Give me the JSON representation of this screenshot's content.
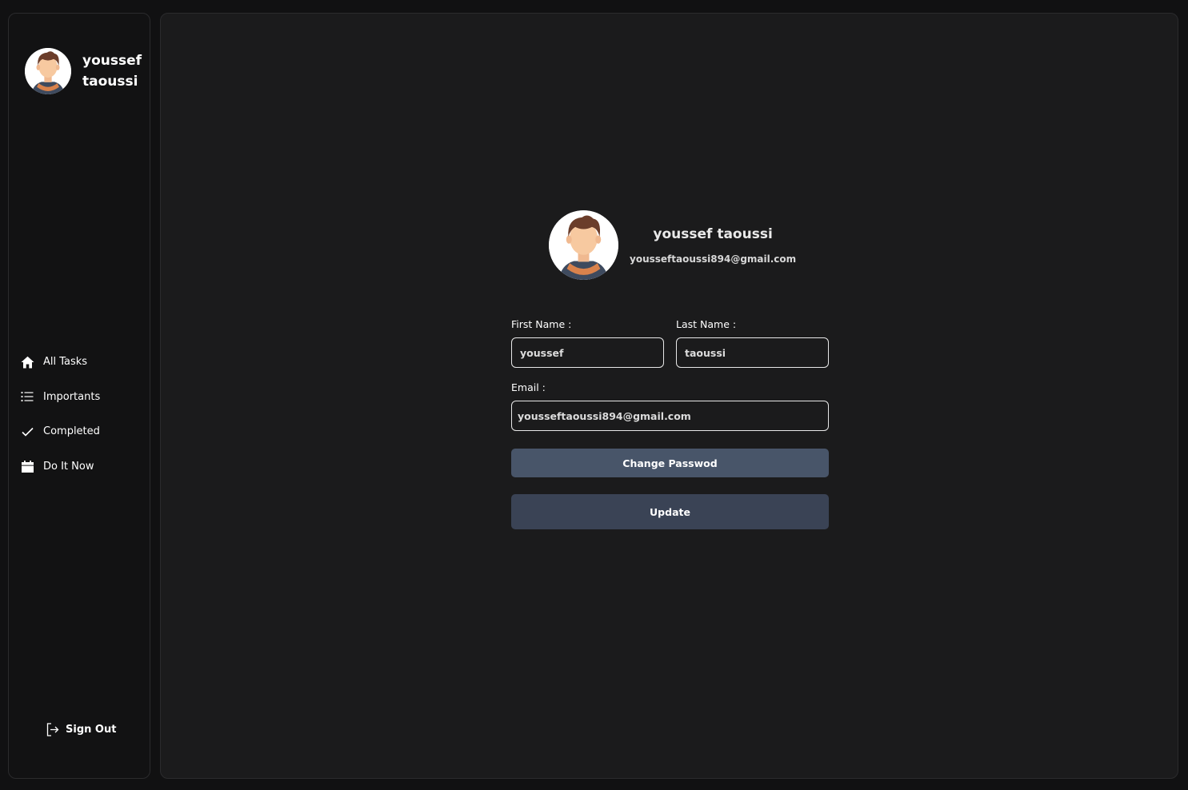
{
  "user": {
    "display_name_line1": "youssef",
    "display_name_line2": "taoussi",
    "full_name": "youssef taoussi",
    "email": "yousseftaoussi894@gmail.com"
  },
  "nav": {
    "items": [
      {
        "label": "All Tasks",
        "icon": "home-icon"
      },
      {
        "label": "Importants",
        "icon": "list-icon"
      },
      {
        "label": "Completed",
        "icon": "check-icon"
      },
      {
        "label": "Do It Now",
        "icon": "calendar-icon"
      }
    ],
    "sign_out": {
      "label": "Sign Out",
      "icon": "sign-out-icon"
    }
  },
  "form": {
    "first_name_label": "First Name :",
    "first_name_value": "youssef",
    "last_name_label": "Last Name :",
    "last_name_value": "taoussi",
    "email_label": "Email :",
    "email_value": "yousseftaoussi894@gmail.com",
    "change_password_label": "Change Passwod",
    "update_label": "Update"
  },
  "colors": {
    "background": "#111112",
    "panel": "#1b1b1c",
    "sidebar": "#121213",
    "change_button": "#485569",
    "update_button": "#3a4355"
  }
}
